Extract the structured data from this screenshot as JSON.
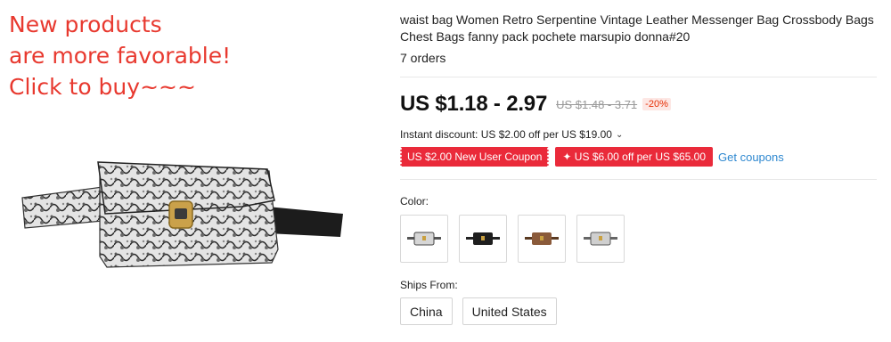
{
  "promo": {
    "lines": [
      "New products",
      "are more favorable!",
      "Click to buy~~~"
    ]
  },
  "product": {
    "title_line1": "waist bag Women Retro Serpentine Vintage Leather Messenger Bag Crossbody Bags",
    "title_line2": "Chest Bags fanny pack pochete marsupio donna#20",
    "orders": "7 orders",
    "price": "US $1.18 - 2.97",
    "original_price": "US $1.48 - 3.71",
    "discount_pct": "-20%",
    "instant_discount": "Instant discount: US $2.00 off per US $19.00",
    "instant_chevron": "⌄",
    "coupons": [
      {
        "label": "US $2.00 New User Coupon"
      },
      {
        "label": "✦ US $6.00 off per US $65.00"
      }
    ],
    "get_coupons": "Get coupons",
    "color_label": "Color:",
    "color_options": [
      {
        "name": "snakeskin-bag-swatch",
        "color": "#d0d0d0"
      },
      {
        "name": "black-bag-swatch",
        "color": "#1e1e1e"
      },
      {
        "name": "brown-bag-swatch",
        "color": "#8a5a3a"
      },
      {
        "name": "snakeskin-bag-swatch-2",
        "color": "#c9c9c9"
      }
    ],
    "ships_from_label": "Ships From:",
    "ships_from": [
      "China",
      "United States"
    ]
  },
  "colors": {
    "promo_red": "#e8392f",
    "coupon_red": "#ea2a3a",
    "link_blue": "#2e88d0"
  }
}
